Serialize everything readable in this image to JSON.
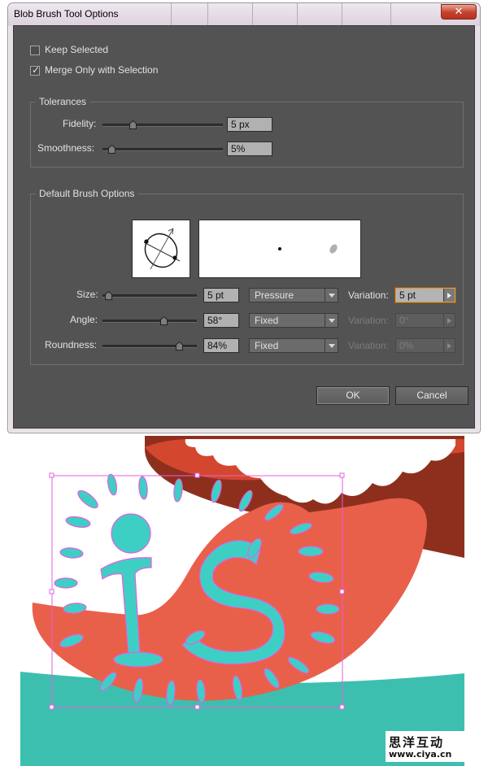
{
  "dialog": {
    "title": "Blob Brush Tool Options",
    "close_symbol": "✕",
    "keep_selected": {
      "label": "Keep Selected",
      "checked": false
    },
    "merge_only": {
      "label": "Merge Only with Selection",
      "checked": true
    },
    "checkmark": "✓",
    "tolerances": {
      "title": "Tolerances",
      "fidelity": {
        "label": "Fidelity:",
        "value": "5 px",
        "slider": 0.24
      },
      "smoothness": {
        "label": "Smoothness:",
        "value": "5%",
        "slider": 0.05
      }
    },
    "brush": {
      "title": "Default Brush Options",
      "size": {
        "label": "Size:",
        "value": "5 pt",
        "slider": 0.03,
        "mode": "Pressure",
        "variation_label": "Variation:",
        "variation": "5 pt",
        "variation_enabled": true
      },
      "angle": {
        "label": "Angle:",
        "value": "58°",
        "slider": 0.66,
        "mode": "Fixed",
        "variation_label": "Variation:",
        "variation": "0°",
        "variation_enabled": false
      },
      "roundness": {
        "label": "Roundness:",
        "value": "84%",
        "slider": 0.84,
        "mode": "Fixed",
        "variation_label": "Variation:",
        "variation": "0%",
        "variation_enabled": false
      }
    },
    "ok_label": "OK",
    "cancel_label": "Cancel"
  },
  "watermark": {
    "text": "思洋互动",
    "url": "www.ciya.cn"
  },
  "colors": {
    "panel": "#535353",
    "tongue": "#e8604a",
    "mouth_dark": "#8e2f1e",
    "teal": "#3dbfb0",
    "letter": "#3ecfc4",
    "selection": "#e85ce0"
  },
  "icons": {
    "dropdown": "chevron-down-icon",
    "stepper": "triangle-right-icon",
    "close": "close-icon"
  }
}
